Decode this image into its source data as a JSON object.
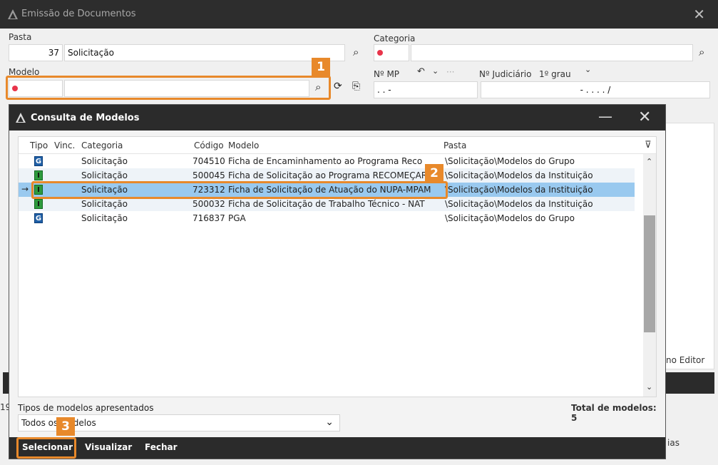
{
  "main": {
    "title": "Emissão de Documentos",
    "pasta_label": "Pasta",
    "pasta_code": "37",
    "pasta_value": "Solicitação",
    "categoria_label": "Categoria",
    "modelo_label": "Modelo",
    "nmp_label": "Nº MP",
    "nmp_value": ".   .        -",
    "judiciario_label": "Nº Judiciário",
    "grau_value": "1º grau",
    "judiciario_value": "-  .   .  .  .   /",
    "editor_text": "no Editor",
    "left_num": "19",
    "bottom_right_text": "ias"
  },
  "badges": [
    "1",
    "2",
    "3"
  ],
  "dialog": {
    "title": "Consulta de Modelos",
    "columns": [
      "Tipo",
      "Vinc.",
      "Categoria",
      "Código",
      "Modelo",
      "Pasta"
    ],
    "rows": [
      {
        "tipo": "G",
        "categoria": "Solicitação",
        "codigo": "704510",
        "modelo": "Ficha de Encaminhamento ao Programa Reco",
        "pasta": "\\Solicitação\\Modelos do Grupo",
        "selected": false
      },
      {
        "tipo": "I",
        "categoria": "Solicitação",
        "codigo": "500045",
        "modelo": "Ficha de Solicitação ao Programa RECOMEÇAR",
        "pasta": "\\Solicitação\\Modelos da Instituição",
        "selected": false
      },
      {
        "tipo": "I",
        "categoria": "Solicitação",
        "codigo": "723312",
        "modelo": "Ficha de Solicitação de Atuação do NUPA-MPAM",
        "pasta": "\\Solicitação\\Modelos da Instituição",
        "selected": true
      },
      {
        "tipo": "I",
        "categoria": "Solicitação",
        "codigo": "500032",
        "modelo": "Ficha de Solicitação de Trabalho Técnico - NAT",
        "pasta": "\\Solicitação\\Modelos da Instituição",
        "selected": false
      },
      {
        "tipo": "G",
        "categoria": "Solicitação",
        "codigo": "716837",
        "modelo": "PGA",
        "pasta": "\\Solicitação\\Modelos do Grupo",
        "selected": false
      }
    ],
    "tipos_label": "Tipos de modelos apresentados",
    "tipos_value": "Todos os Modelos",
    "total_label": "Total de modelos: 5",
    "btn_selecionar": "Selecionar",
    "btn_visualizar": "Visualizar",
    "btn_fechar": "Fechar"
  },
  "colors": {
    "accent": "#e8892b",
    "selected_row": "#99c9ef",
    "titlebar": "#2b2b2b"
  }
}
